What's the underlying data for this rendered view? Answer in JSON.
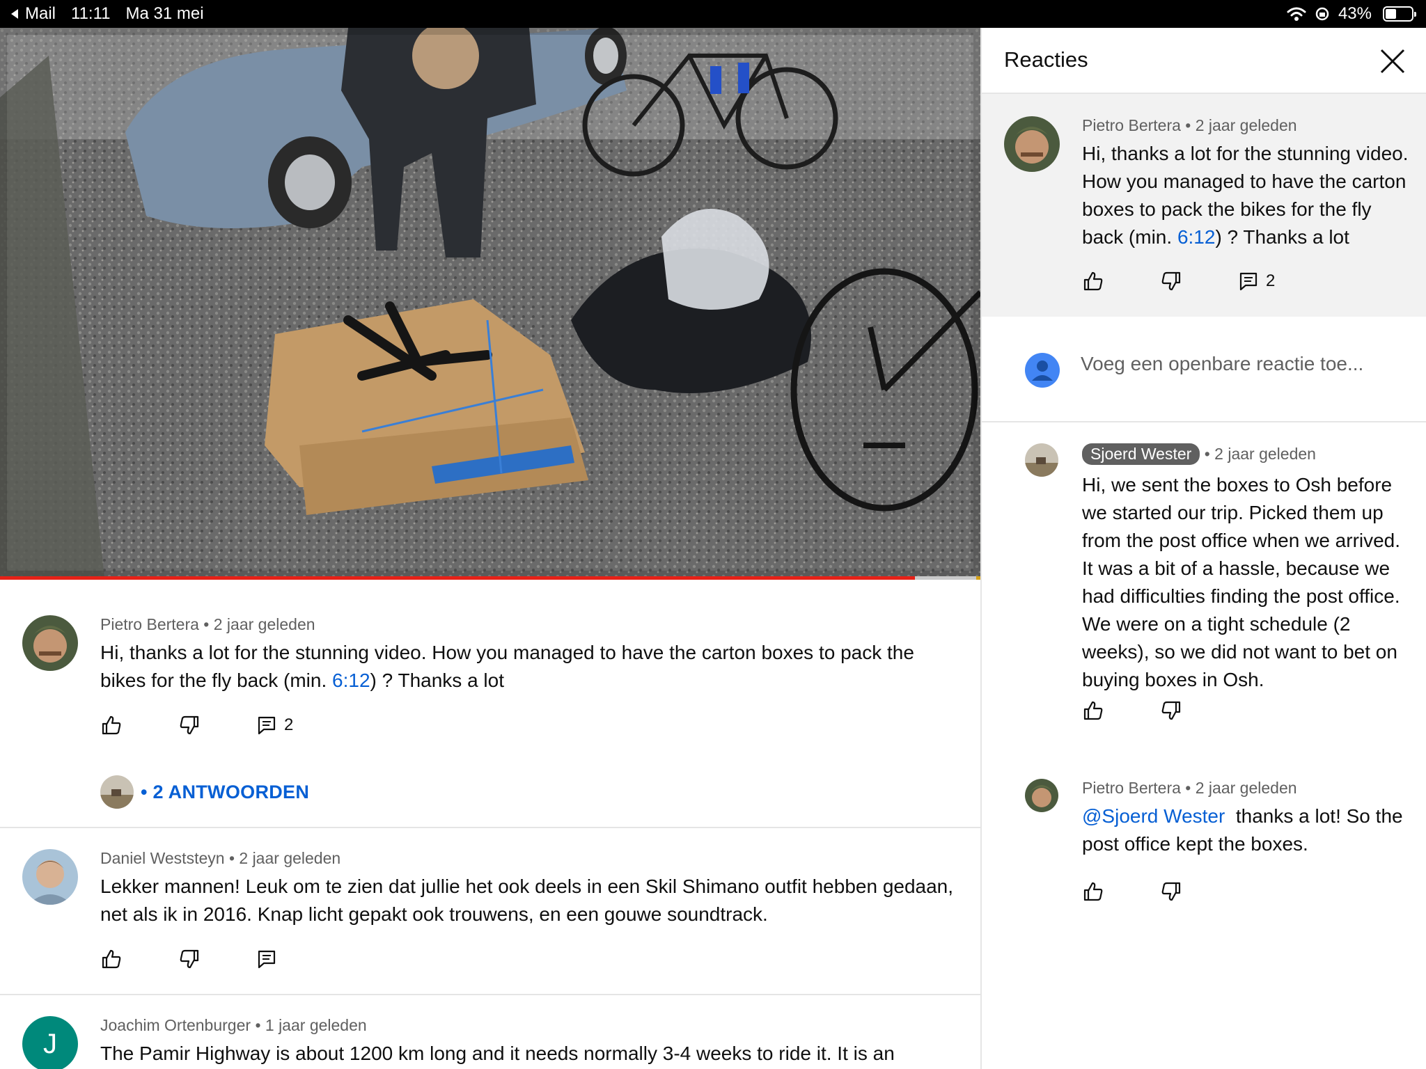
{
  "status_bar": {
    "back_label": "Mail",
    "time": "11:11",
    "date": "Ma 31 mei",
    "battery": "43%",
    "battery_level": 0.43
  },
  "video": {
    "progress": 0.933
  },
  "comments": [
    {
      "author": "Pietro Bertera",
      "age": "2 jaar geleden",
      "text_before": "Hi, thanks a lot for the stunning video. How you managed to have the carton boxes to pack the bikes for the fly back (min. ",
      "timestamp": "6:12",
      "text_after": ") ? Thanks a lot",
      "reply_count": "2",
      "replies_label": "• 2 ANTWOORDEN"
    },
    {
      "author": "Daniel Weststeyn",
      "age": "2 jaar geleden",
      "text": "Lekker mannen! Leuk om te zien dat jullie het ook deels in een Skil Shimano outfit hebben gedaan, net als ik in 2016. Knap licht gepakt ook trouwens, en een gouwe soundtrack."
    },
    {
      "author": "Joachim Ortenburger",
      "age": "1 jaar geleden",
      "avatar_letter": "J",
      "text": "The Pamir Highway is about 1200 km long and it needs normally 3-4 weeks to ride it. It is an"
    }
  ],
  "panel": {
    "title": "Reacties",
    "pinned": {
      "author": "Pietro Bertera",
      "age": "2 jaar geleden",
      "text_before": "Hi, thanks a lot for the stunning video. How you managed to have the carton boxes to pack the bikes for the fly back (min. ",
      "timestamp": "6:12",
      "text_after": ") ? Thanks a lot",
      "reply_count": "2"
    },
    "reply_placeholder": "Voeg een openbare reactie toe...",
    "replies": [
      {
        "author": "Sjoerd Wester",
        "age": "2 jaar geleden",
        "text": "Hi, we sent the boxes to Osh before we started our trip. Picked them up from the post office when we arrived. It was a bit of a hassle, because we had difficulties finding the post office. We were on a tight schedule (2 weeks), so we did not want to bet on buying boxes in Osh."
      },
      {
        "author": "Pietro Bertera",
        "age": "2 jaar geleden",
        "mention": "@Sjoerd Wester",
        "text": "thanks a lot! So the post office kept the boxes."
      }
    ]
  },
  "colors": {
    "link": "#065fd4",
    "progress": "#e62117",
    "meta": "#606060",
    "avatar_j": "#00897b"
  }
}
